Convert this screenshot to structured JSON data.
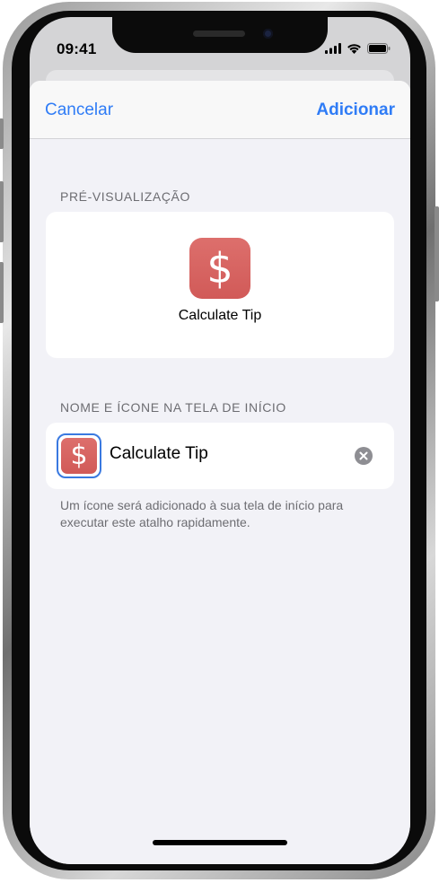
{
  "status_bar": {
    "time": "09:41"
  },
  "nav": {
    "cancel_label": "Cancelar",
    "add_label": "Adicionar"
  },
  "preview": {
    "section_title": "PRÉ-VISUALIZAÇÃO",
    "icon_glyph": "$",
    "icon_color": "#d9625f",
    "app_name": "Calculate Tip"
  },
  "home_screen": {
    "section_title": "NOME E ÍCONE NA TELA DE INÍCIO",
    "icon_glyph": "$",
    "name_value": "Calculate Tip",
    "footer_note": "Um ícone será adicionado à sua tela de início para executar este atalho rapidamente."
  },
  "colors": {
    "accent": "#2f7cf6",
    "background": "#f2f2f7"
  }
}
